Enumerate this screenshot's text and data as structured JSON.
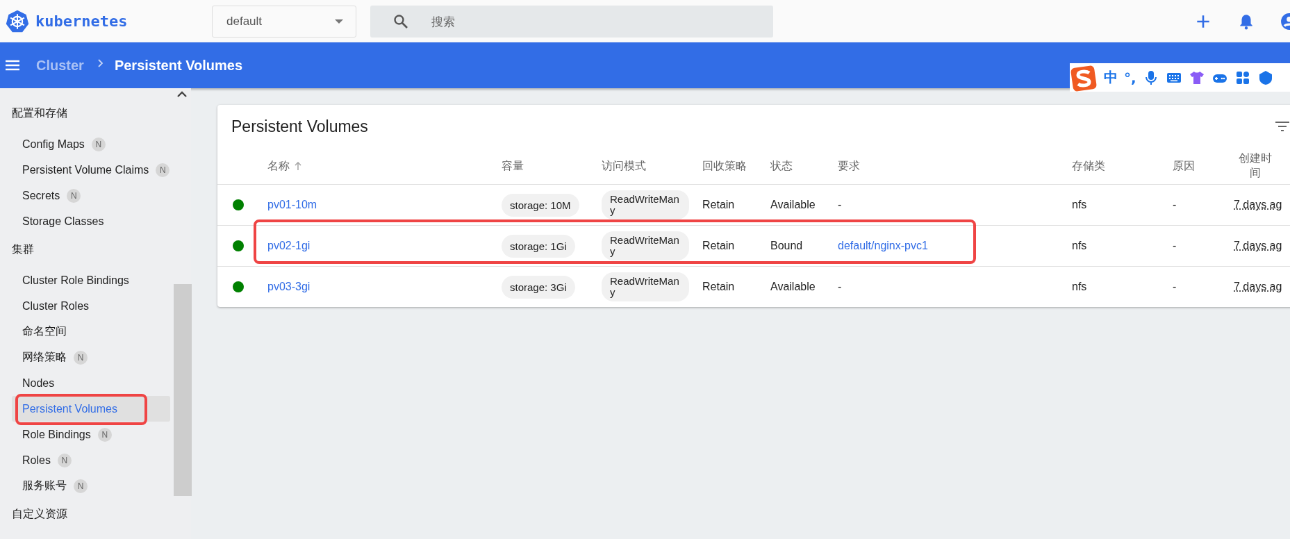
{
  "topbar": {
    "logo_text": "kubernetes",
    "namespace": "default",
    "search": {
      "placeholder": "搜索"
    }
  },
  "breadcrumb": {
    "parent": "Cluster",
    "current": "Persistent Volumes"
  },
  "ime_toolbar": {
    "mode": "中",
    "punctuation": "°,"
  },
  "sidebar": {
    "sections": [
      {
        "title": "配置和存储",
        "items": [
          {
            "label": "Config Maps",
            "badge": "N",
            "selected": false,
            "annotated": false
          },
          {
            "label": "Persistent Volume Claims",
            "badge": "N",
            "selected": false,
            "annotated": false
          },
          {
            "label": "Secrets",
            "badge": "N",
            "selected": false,
            "annotated": false
          },
          {
            "label": "Storage Classes",
            "selected": false,
            "annotated": false
          }
        ]
      },
      {
        "title": "集群",
        "items": [
          {
            "label": "Cluster Role Bindings",
            "selected": false,
            "annotated": false
          },
          {
            "label": "Cluster Roles",
            "selected": false,
            "annotated": false
          },
          {
            "label": "命名空间",
            "selected": false,
            "annotated": false
          },
          {
            "label": "网络策略",
            "badge": "N",
            "selected": false,
            "annotated": false
          },
          {
            "label": "Nodes",
            "selected": false,
            "annotated": false
          },
          {
            "label": "Persistent Volumes",
            "selected": true,
            "annotated": true
          },
          {
            "label": "Role Bindings",
            "badge": "N",
            "selected": false,
            "annotated": false
          },
          {
            "label": "Roles",
            "badge": "N",
            "selected": false,
            "annotated": false
          },
          {
            "label": "服务账号",
            "badge": "N",
            "selected": false,
            "annotated": false
          }
        ]
      },
      {
        "title": "自定义资源"
      }
    ]
  },
  "card": {
    "title": "Persistent Volumes",
    "columns": [
      "名称",
      "容量",
      "访问模式",
      "回收策略",
      "状态",
      "要求",
      "存储类",
      "原因",
      "创建时间"
    ],
    "rows": [
      {
        "color": "#008000",
        "name": "pv01-10m",
        "capacity": "storage: 10M",
        "access": "ReadWriteMany",
        "reclaim": "Retain",
        "status": "Available",
        "claim": "-",
        "claim_link": false,
        "storage_class": "nfs",
        "reason": "-",
        "created": "7 days ag",
        "annotated": false
      },
      {
        "color": "#008000",
        "name": "pv02-1gi",
        "capacity": "storage: 1Gi",
        "access": "ReadWriteMany",
        "reclaim": "Retain",
        "status": "Bound",
        "claim": "default/nginx-pvc1",
        "claim_link": true,
        "storage_class": "nfs",
        "reason": "-",
        "created": "7 days ag",
        "annotated": true
      },
      {
        "color": "#008000",
        "name": "pv03-3gi",
        "capacity": "storage: 3Gi",
        "access": "ReadWriteMany",
        "reclaim": "Retain",
        "status": "Available",
        "claim": "-",
        "claim_link": false,
        "storage_class": "nfs",
        "reason": "-",
        "created": "7 days ag",
        "annotated": false
      }
    ]
  }
}
